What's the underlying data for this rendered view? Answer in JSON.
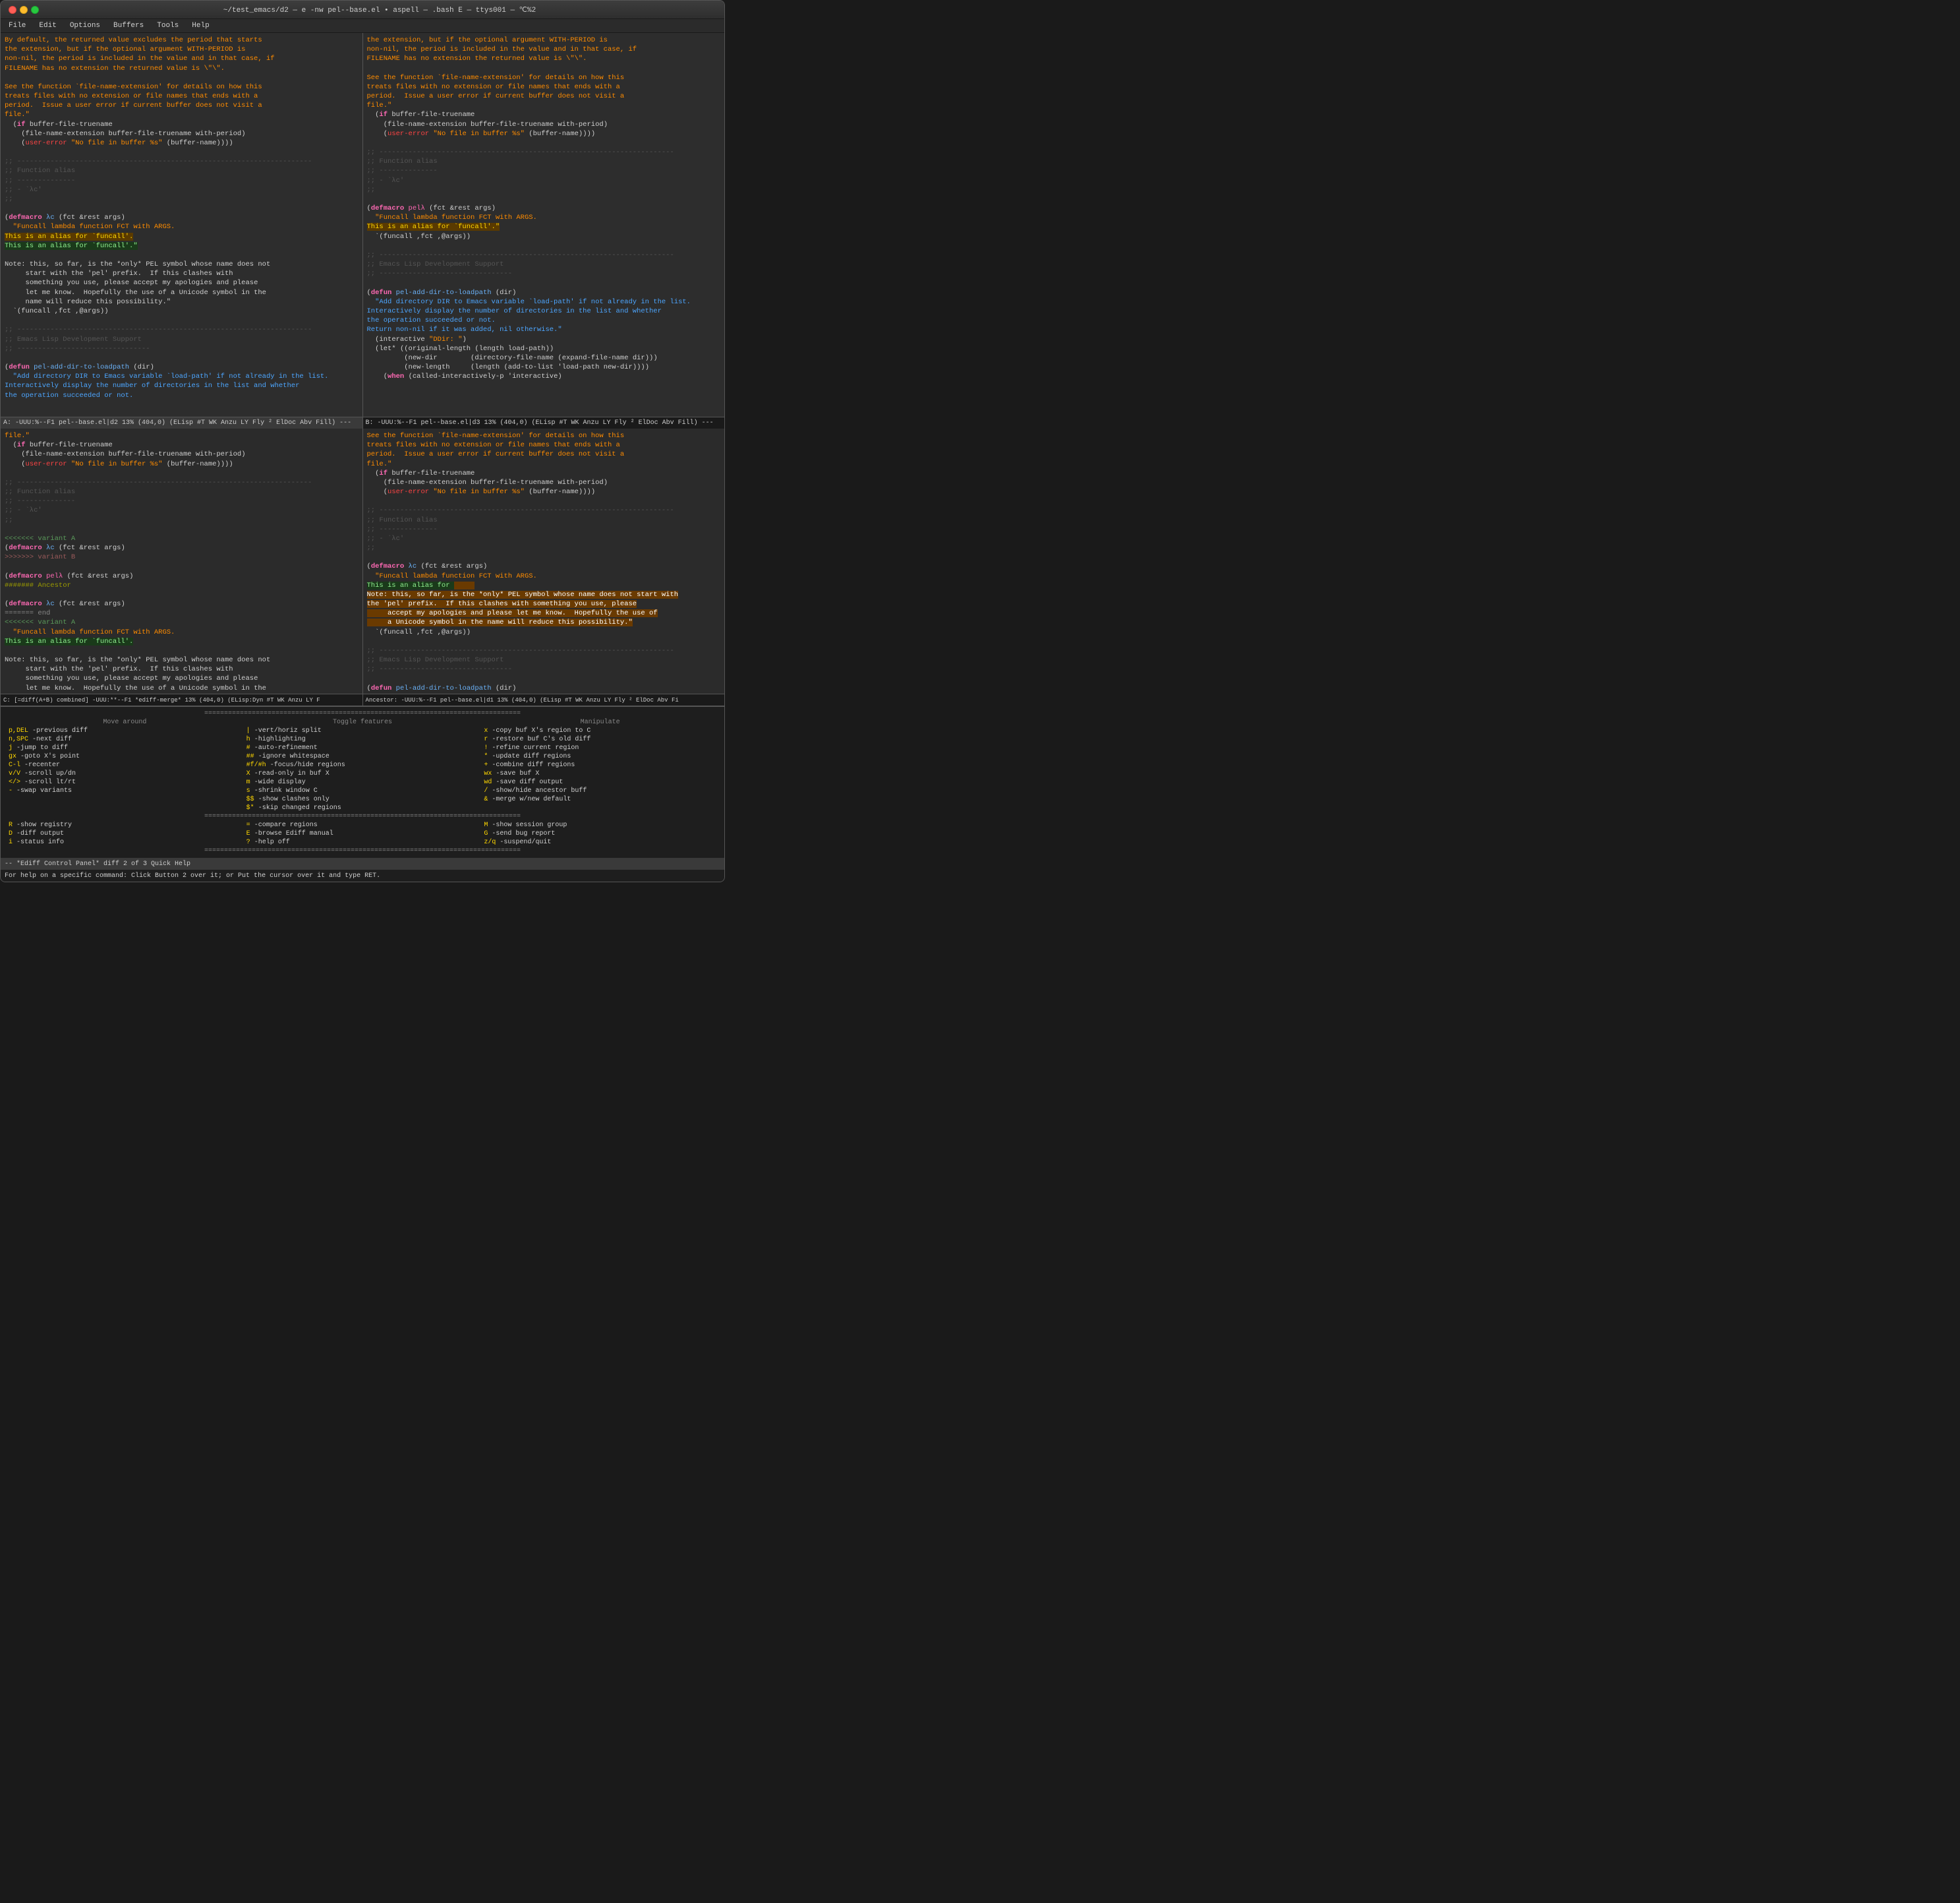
{
  "window": {
    "titlebar": "~/test_emacs/d2 — e -nw pel--base.el • aspell — .bash E — ttys001 — ℃%2",
    "traffic_lights": [
      "close",
      "minimize",
      "maximize"
    ]
  },
  "menubar": {
    "items": [
      "File",
      "Edit",
      "Options",
      "Buffers",
      "Tools",
      "Help"
    ]
  },
  "pane_a": {
    "modeline": "A: -UUU:%--F1  pel--base.el|d2   13% (404,0)   (ELisp #T WK Anzu LY Fly ² ElDoc Abv Fill) ---"
  },
  "pane_b": {
    "modeline": "B: -UUU:%--F1  pel--base.el|d3   13% (404,0)   (ELisp #T WK Anzu LY Fly ² ElDoc Abv Fill) ---"
  },
  "pane_c": {
    "modeline": "C: [=diff(A+B) combined] -UUU:**--F1  *ediff-merge*   13% (404,0)   (ELisp:Dyn #T WK Anzu LY F"
  },
  "pane_ancestor": {
    "modeline": "Ancestor: -UUU:%--F1  pel--base.el|d1   13% (404,0)   (ELisp #T WK Anzu LY Fly ² ElDoc Abv Fi"
  },
  "bottom_modeline": "-- *Ediff Control Panel*   diff 2 of 3      Quick Help",
  "echo_area": "For help on a specific command:  Click Button 2 over it; or\n    Put the cursor over it and type RET.",
  "control_panel": {
    "section_labels": [
      "Move around",
      "Toggle features",
      "Manipulate"
    ],
    "rows": [
      [
        "p,DEL -previous diff",
        "-vert/horiz split",
        "x -copy buf X's region to C"
      ],
      [
        "n,SPC -next diff",
        "h -highlighting",
        "r -restore buf C's old diff"
      ],
      [
        "j -jump to diff",
        "# -auto-refinement",
        "! -refine current region"
      ],
      [
        "gx -goto X's point",
        "## -ignore whitespace",
        "* -update diff regions"
      ],
      [
        "C-l -recenter",
        "#f/#h -focus/hide regions",
        "+ -combine diff regions"
      ],
      [
        "v/V -scroll up/dn",
        "X -read-only in buf X",
        "wx -save buf X"
      ],
      [
        "</> -scroll lt/rt",
        "m -wide display",
        "wd -save diff output"
      ],
      [
        "- -swap variants",
        "s -shrink window C",
        "/ -show/hide ancestor buff"
      ],
      [
        "",
        "$$ -show clashes only",
        "& -merge w/new default"
      ],
      [
        "",
        "$* -skip changed regions",
        ""
      ]
    ],
    "row2_labels": [
      "R -show registry",
      "= -compare regions",
      "M  -show session group"
    ],
    "row2_vals": [
      "D -diff output",
      "E -browse Ediff manual",
      "G  -send bug report"
    ],
    "row3_vals": [
      "i -status info",
      "? -help off",
      "z/q -suspend/quit"
    ]
  }
}
